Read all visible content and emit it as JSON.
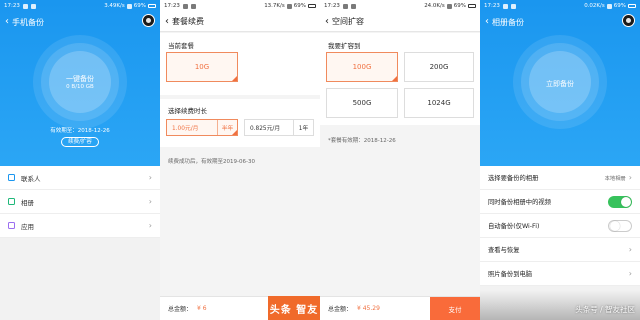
{
  "colors": {
    "primary_blue": "#1e9df2",
    "accent_orange": "#f07040",
    "pay_orange": "#f96b3a",
    "toggle_on": "#37c25c"
  },
  "screens": [
    {
      "status": {
        "time": "17:23",
        "speed": "3.49K/s",
        "battery": "69%"
      },
      "title": "手机备份",
      "backup_button": {
        "label": "一键备份",
        "usage": "0 B/10 GB"
      },
      "expiry": "有效期至：2018-12-26",
      "renew_label": "续费/扩容",
      "menu": [
        {
          "label": "联系人",
          "icon": "contacts-icon"
        },
        {
          "label": "相册",
          "icon": "photo-album-icon"
        },
        {
          "label": "应用",
          "icon": "apps-grid-icon"
        }
      ]
    },
    {
      "status": {
        "time": "17:23",
        "speed": "13.7K/s",
        "battery": "69%"
      },
      "title": "套餐续费",
      "current_plan_label": "当前套餐",
      "current_plan": "10G",
      "duration_label": "选择续费时长",
      "prices": [
        {
          "price": "1.00元/月",
          "unit": "半年"
        },
        {
          "price": "0.825元/月",
          "unit": "1年"
        }
      ],
      "note": "续费成功后，有效期至2019-06-30",
      "total_label": "总金额：",
      "total_value": "¥ 6",
      "watermark": "头条 智友"
    },
    {
      "status": {
        "time": "17:23",
        "speed": "24.0K/s",
        "battery": "69%"
      },
      "title": "空间扩容",
      "expand_label": "我要扩容到",
      "options": [
        "100G",
        "200G",
        "500G",
        "1024G"
      ],
      "expiry_note": "*套餐有效期：2018-12-26",
      "total_label": "总金额：",
      "total_value": "¥ 45.29",
      "pay_label": "支付"
    },
    {
      "status": {
        "time": "17:23",
        "speed": "0.02K/s",
        "battery": "69%"
      },
      "title": "相册备份",
      "backup_button": {
        "label": "立即备份"
      },
      "settings": [
        {
          "label": "选择要备份的相册",
          "value": "本地相册",
          "type": "nav"
        },
        {
          "label": "同时备份相册中的视频",
          "type": "toggle",
          "on": true
        },
        {
          "label": "自动备份(仅Wi-Fi)",
          "type": "toggle",
          "on": false
        },
        {
          "label": "查看与恢复",
          "type": "nav"
        },
        {
          "label": "照片备份到电脑",
          "type": "nav"
        }
      ],
      "credit": "头条号 / 智友社区"
    }
  ]
}
